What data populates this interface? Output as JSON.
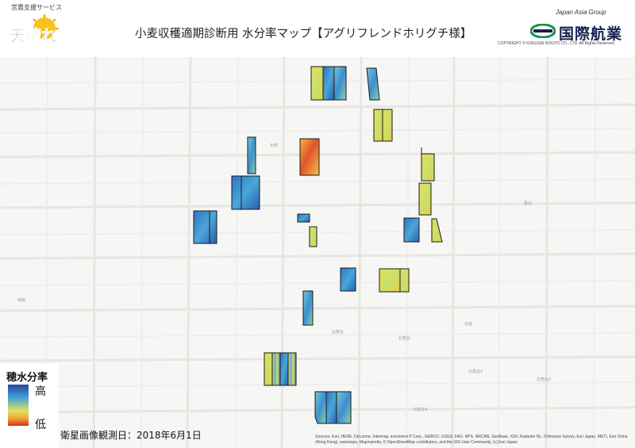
{
  "header": {
    "service_name": "営農支援サービス",
    "logo_text": "天晴れ",
    "title": "小麦収穫適期診断用 水分率マップ【アグリフレンドホリグチ様】",
    "company_group": "Japan Asia Group",
    "company_name": "国際航業",
    "copyright": "COPYRIGHT © KOKUSAI KOGYO CO., LTD. All Rights Reserved."
  },
  "legend": {
    "title": "穂水分率",
    "high_label": "高",
    "low_label": "低",
    "colors": [
      "#27459a",
      "#3fa2d8",
      "#e3e35a",
      "#f0a43a",
      "#d8301b"
    ]
  },
  "observation_date": "衛星画像観測日：2018年6月1日",
  "attribution": "Sources: Esri, HERE, DeLorme, Intermap, increment P Corp., GEBCO, USGS, FAO, NPS, NRCAN, GeoBase, IGN, Kadaster NL, Ordnance Survey, Esri Japan, METI, Esri China (Hong Kong), swisstopo, Mapmyindia, © OpenStreetMap contributors, and the GIS User Community, (c) Esri Japan",
  "place_labels": [
    "石狩",
    "豊北",
    "弘恵台",
    "北進",
    "北恵台",
    "北恵台2",
    "北恵台3",
    "北恵台4",
    "西南"
  ],
  "colors": {
    "field_outline": "#1a1a1a",
    "road": "#e9e9e6",
    "base": "#f6f6f4"
  }
}
